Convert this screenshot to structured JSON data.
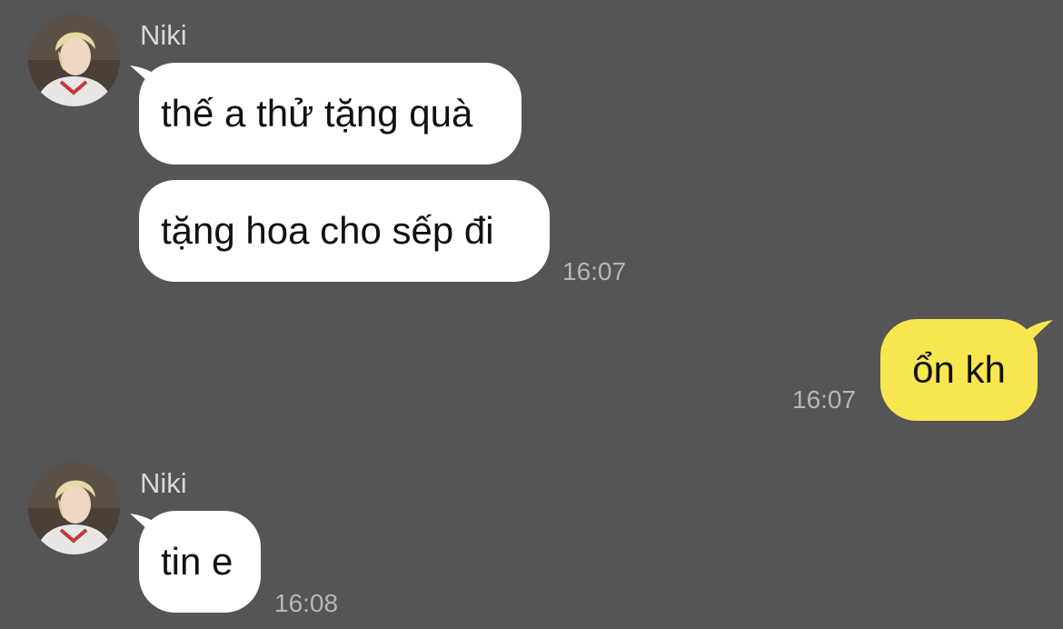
{
  "messages": [
    {
      "sender": "Niki",
      "bubbles": [
        "thế a thử tặng quà",
        "tặng hoa cho sếp đi"
      ],
      "time": "16:07"
    },
    {
      "sender": "me",
      "bubbles": [
        "ổn kh"
      ],
      "time": "16:07"
    },
    {
      "sender": "Niki",
      "bubbles": [
        "tin e"
      ],
      "time": "16:08"
    }
  ],
  "colors": {
    "background": "#555456",
    "incoming_bubble": "#ffffff",
    "outgoing_bubble": "#f8e650",
    "sender_name": "#d8d8d8",
    "timestamp": "#b6b6b6"
  },
  "icons": {
    "avatar": "contact-avatar-photo"
  }
}
